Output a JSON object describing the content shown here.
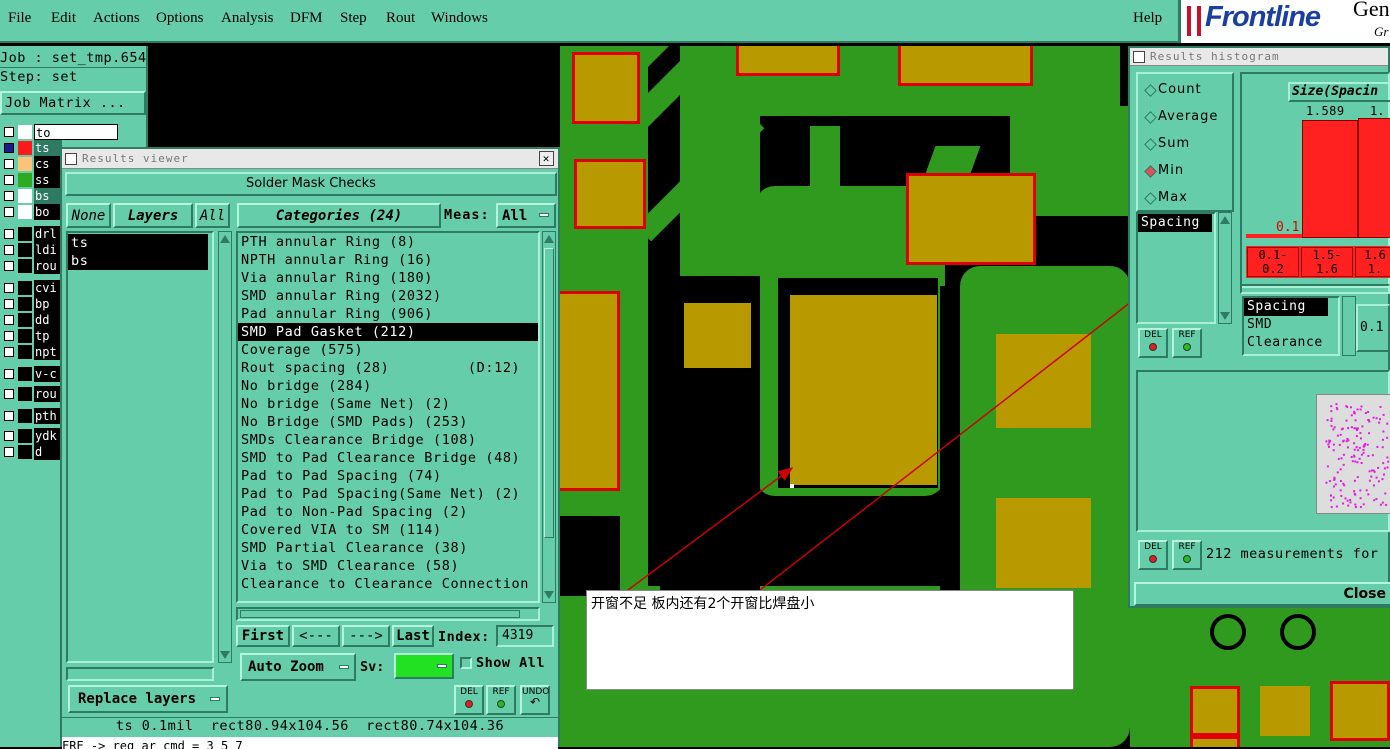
{
  "menubar": {
    "items": [
      "File",
      "Edit",
      "Actions",
      "Options",
      "Analysis",
      "DFM",
      "Step",
      "Rout",
      "Windows"
    ],
    "help": "Help",
    "logo_brand": "Frontline",
    "logo_trail": "Gen",
    "logo_sub": "Gr"
  },
  "left_panel": {
    "job": "Job : set_tmp.654",
    "step": "Step: set",
    "job_matrix": "Job Matrix ...",
    "layers": [
      {
        "name": "to",
        "color": "#ffffff",
        "wide": true
      },
      {
        "name": "ts",
        "color": "#ff1a1a"
      },
      {
        "name": "cs",
        "color": "#ffc27a"
      },
      {
        "name": "ss",
        "color": "#2eaa1e"
      },
      {
        "name": "bs",
        "color": "#ffffff"
      },
      {
        "name": "bo",
        "color": "#ffffff"
      },
      {
        "name": "drl",
        "color": "#000000"
      },
      {
        "name": "ldi",
        "color": "#000000"
      },
      {
        "name": "rou",
        "color": "#000000"
      },
      {
        "name": "cvi",
        "color": "#000000"
      },
      {
        "name": "bp",
        "color": "#000000"
      },
      {
        "name": "dd",
        "color": "#000000"
      },
      {
        "name": "tp",
        "color": "#000000"
      },
      {
        "name": "npt",
        "color": "#000000"
      },
      {
        "name": "v-c",
        "color": "#000000"
      },
      {
        "name": "rou",
        "color": "#000000"
      },
      {
        "name": "pth",
        "color": "#000000"
      },
      {
        "name": "ydk",
        "color": "#000000"
      },
      {
        "name": "d",
        "color": "#000000"
      }
    ]
  },
  "results_viewer": {
    "title": "Results viewer",
    "header": "Solder Mask Checks",
    "none_btn": "None",
    "layers_btn": "Layers",
    "all_btn": "All",
    "categories_label": "Categories (24)",
    "meas_label": "Meas:",
    "meas_value": "All",
    "layers": [
      "ts",
      "bs"
    ],
    "categories": [
      "PTH annular Ring (8)",
      "NPTH annular Ring (16)",
      "Via annular Ring (180)",
      "SMD annular Ring (2032)",
      "Pad annular Ring (906)",
      "SMD Pad Gasket (212)",
      "Coverage (575)",
      "Rout spacing (28)         (D:12)",
      "No bridge (284)",
      "No bridge (Same Net) (2)",
      "No Bridge (SMD Pads) (253)",
      "SMDs Clearance Bridge (108)",
      "SMD to Pad Clearance Bridge (48)",
      "Pad to Pad Spacing (74)",
      "Pad to Pad Spacing(Same Net) (2)",
      "Pad to Non-Pad Spacing (2)",
      "Covered VIA to SM (114)",
      "SMD Partial Clearance (38)",
      "Via to SMD Clearance (58)",
      "Clearance to Clearance Connection"
    ],
    "selected_index": 5,
    "nav": {
      "first": "First",
      "prev": "<---",
      "next": "--->",
      "last": "Last",
      "index_label": "Index:",
      "index_value": "4319"
    },
    "auto_zoom": "Auto Zoom",
    "sv_label": "Sv:",
    "show_all": "Show All",
    "replace_layers": "Replace layers",
    "del": "DEL",
    "ref": "REF",
    "undo": "UNDO",
    "status": "ts 0.1mil  rect80.94x104.56  rect80.74x104.36",
    "cmd": "FRE -> reg ar cmd = 3 5 7"
  },
  "histogram": {
    "title": "Results histogram",
    "modes": [
      "Count",
      "Average",
      "Sum",
      "Min",
      "Max"
    ],
    "selected_mode": "Min",
    "chart_title": "Size(Spacin",
    "bar_values": [
      "1.589",
      "1."
    ],
    "min_label": "0.1",
    "bins": [
      "0.1-\n0.2",
      "1.5-\n1.6",
      "1.6\n1."
    ],
    "list1": [
      "Spacing"
    ],
    "list2": [
      "Spacing",
      "SMD",
      "Clearance"
    ],
    "value_box": "0.1",
    "del": "DEL",
    "ref": "REF",
    "footer": "212 measurements for",
    "close": "Close"
  },
  "annotation": {
    "text": "开窗不足 板内还有2个开窗比焊盘小"
  },
  "colors": {
    "ui": "#66cdaa",
    "copper": "#2f9a1e",
    "pad": "#b89a00",
    "flag": "#e00000",
    "arrow": "#cc0000"
  }
}
